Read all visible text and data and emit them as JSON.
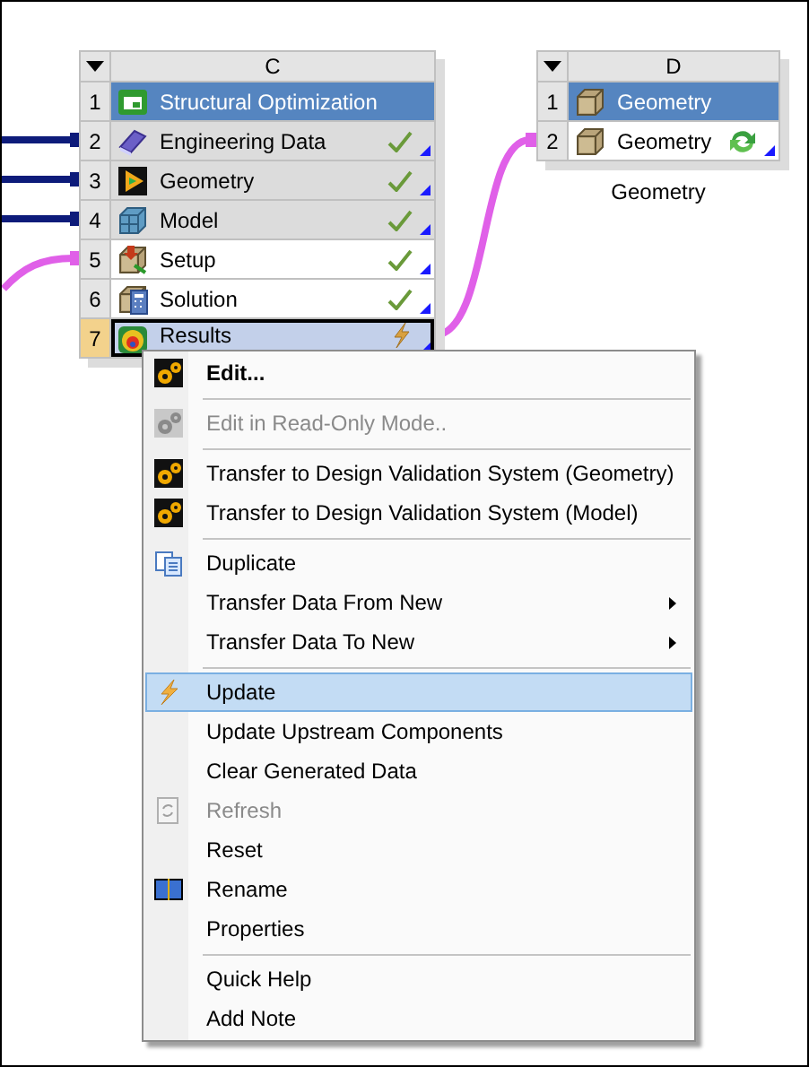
{
  "systems": [
    {
      "column": "C",
      "rows": [
        {
          "number": "1",
          "label": "Structural Optimization",
          "kind": "title",
          "selected": false
        },
        {
          "number": "2",
          "label": "Engineering Data",
          "kind": "cell",
          "status": {
            "kind": "ok"
          },
          "shaded": true,
          "selected": false
        },
        {
          "number": "3",
          "label": "Geometry",
          "kind": "cell",
          "status": {
            "kind": "ok"
          },
          "shaded": true,
          "selected": false
        },
        {
          "number": "4",
          "label": "Model",
          "kind": "cell",
          "status": {
            "kind": "ok"
          },
          "shaded": true,
          "selected": false
        },
        {
          "number": "5",
          "label": "Setup",
          "kind": "cell",
          "status": {
            "kind": "ok"
          },
          "shaded": false,
          "selected": false
        },
        {
          "number": "6",
          "label": "Solution",
          "kind": "cell",
          "status": {
            "kind": "ok"
          },
          "shaded": false,
          "selected": false
        },
        {
          "number": "7",
          "label": "Results",
          "kind": "cell",
          "status": {
            "kind": "update"
          },
          "shaded": false,
          "selected": true
        }
      ]
    },
    {
      "column": "D",
      "caption": "Geometry",
      "rows": [
        {
          "number": "1",
          "label": "Geometry",
          "kind": "title",
          "selected": false
        },
        {
          "number": "2",
          "label": "Geometry",
          "kind": "cell",
          "status": {
            "kind": "refresh"
          },
          "shaded": false,
          "selected": false
        }
      ]
    }
  ],
  "context_menu": {
    "groups": [
      [
        {
          "label": "Edit...",
          "default": true,
          "disabled": false,
          "selected": false
        }
      ],
      [
        {
          "label": "Edit in Read-Only Mode..",
          "disabled": true,
          "selected": false
        }
      ],
      [
        {
          "label": "Transfer to Design Validation System (Geometry)",
          "disabled": false,
          "selected": false
        },
        {
          "label": "Transfer to Design Validation System (Model)",
          "disabled": false,
          "selected": false
        }
      ],
      [
        {
          "label": "Duplicate",
          "disabled": false,
          "selected": false
        },
        {
          "label": "Transfer Data From New",
          "submenu": true,
          "disabled": false,
          "selected": false
        },
        {
          "label": "Transfer Data To New",
          "submenu": true,
          "disabled": false,
          "selected": false
        }
      ],
      [
        {
          "label": "Update",
          "disabled": false,
          "selected": true
        },
        {
          "label": "Update Upstream Components",
          "disabled": false,
          "selected": false
        },
        {
          "label": "Clear Generated Data",
          "disabled": false,
          "selected": false
        },
        {
          "label": "Refresh",
          "disabled": true,
          "selected": false
        },
        {
          "label": "Reset",
          "disabled": false,
          "selected": false
        },
        {
          "label": "Rename",
          "disabled": false,
          "selected": false
        },
        {
          "label": "Properties",
          "disabled": false,
          "selected": false
        }
      ],
      [
        {
          "label": "Quick Help",
          "disabled": false,
          "selected": false
        },
        {
          "label": "Add Note",
          "disabled": false,
          "selected": false
        }
      ]
    ]
  }
}
